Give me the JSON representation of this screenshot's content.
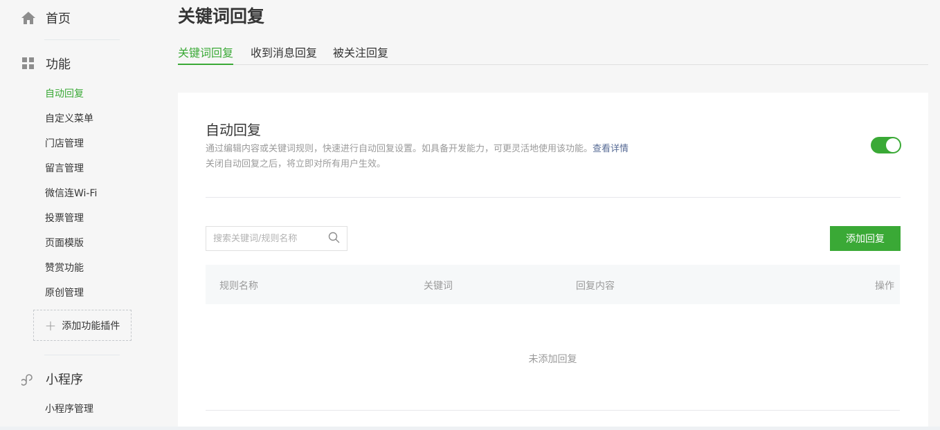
{
  "sidebar": {
    "home_label": "首页",
    "function_label": "功能",
    "items": [
      {
        "label": "自动回复",
        "active": true
      },
      {
        "label": "自定义菜单",
        "active": false
      },
      {
        "label": "门店管理",
        "active": false
      },
      {
        "label": "留言管理",
        "active": false
      },
      {
        "label": "微信连Wi-Fi",
        "active": false
      },
      {
        "label": "投票管理",
        "active": false
      },
      {
        "label": "页面模版",
        "active": false
      },
      {
        "label": "赞赏功能",
        "active": false
      },
      {
        "label": "原创管理",
        "active": false
      }
    ],
    "add_plugin_label": "添加功能插件",
    "miniprogram_label": "小程序",
    "miniprogram_items": [
      {
        "label": "小程序管理"
      }
    ],
    "icons": {
      "home": "home-icon",
      "function": "grid-icon",
      "miniprogram": "link-icon",
      "add": "plus-icon"
    }
  },
  "main": {
    "page_title": "关键词回复",
    "tabs": [
      {
        "label": "关键词回复",
        "active": true
      },
      {
        "label": "收到消息回复",
        "active": false
      },
      {
        "label": "被关注回复",
        "active": false
      }
    ],
    "section": {
      "title": "自动回复",
      "description": "通过编辑内容或关键词规则，快速进行自动回复设置。如具备开发能力，可更灵活地使用该功能。",
      "detail_link": "查看详情",
      "note": "关闭自动回复之后，将立即对所有用户生效。",
      "enabled": true
    },
    "search": {
      "placeholder": "搜索关键词/规则名称",
      "value": ""
    },
    "add_button": "添加回复",
    "table": {
      "columns": [
        "规则名称",
        "关键词",
        "回复内容",
        "操作"
      ],
      "rows": [],
      "empty_text": "未添加回复"
    }
  },
  "colors": {
    "accent": "#3aa936",
    "link": "#576b95",
    "muted": "#9a9a9a",
    "background": "#f6f6f6"
  }
}
